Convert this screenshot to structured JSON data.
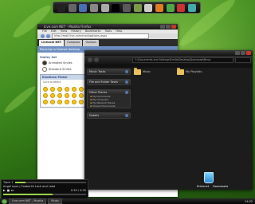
{
  "dock": {
    "icons": [
      {
        "name": "terminal-icon",
        "color": "#222"
      },
      {
        "name": "hard-drive-icon",
        "color": "#666"
      },
      {
        "name": "network-icon",
        "color": "#4a6fb0"
      },
      {
        "name": "user-folder-icon",
        "color": "#888"
      },
      {
        "name": "documents-icon",
        "color": "#aaa"
      },
      {
        "name": "gap-icon",
        "color": "#000"
      },
      {
        "name": "display-icon",
        "color": "#5a5a5a"
      },
      {
        "name": "image-icon",
        "color": "#7a9a4a"
      },
      {
        "name": "music-icon",
        "color": "#ccc"
      },
      {
        "name": "firefox-icon",
        "color": "#e07b20"
      },
      {
        "name": "messenger-icon",
        "color": "#4aa84a"
      },
      {
        "name": "settings-icon",
        "color": "#c33"
      },
      {
        "name": "trash-icon",
        "color": "#4aa"
      }
    ]
  },
  "browser": {
    "title": "Live.com NET - Mozilla Firefox",
    "menu": [
      "File",
      "Edit",
      "View",
      "History",
      "Bookmarks",
      "Tools",
      "Help"
    ],
    "url": "http://mail.live.com/mail/options.aspx",
    "tabs": [
      "Livecom NET",
      "Compose",
      "Options"
    ],
    "header": "Replying to Hotmail Desktop",
    "section_smile": "Smiley Set",
    "options": [
      {
        "label": "Animated Smiles",
        "checked": true
      },
      {
        "label": "Standard Smiles",
        "checked": false
      }
    ],
    "box_title": "Emoticon Picker",
    "box_subtitle": "Click to select"
  },
  "explorer": {
    "address": "C:\\Documents and Settings\\Emilio\\Desktop\\Download\\Music",
    "panes": [
      {
        "title": "Music Tasks",
        "items": []
      },
      {
        "title": "File and Folder Tasks",
        "items": []
      },
      {
        "title": "Other Places",
        "items": [
          "My Documents",
          "My Computer",
          "My Network Places",
          "Shared Documents"
        ]
      },
      {
        "title": "Details",
        "items": []
      }
    ],
    "folders": [
      "Music",
      "My Playlists"
    ]
  },
  "desktop": {
    "recycle_bin_label": "Ethernet",
    "downloads_label": "Downloads"
  },
  "player": {
    "line1": "Track 1",
    "line2": "Angel eyes | Foobar2k Lock and Load",
    "time": "0:39 / 4:35",
    "progress": 0.15,
    "volume": 0.6
  },
  "taskbar": {
    "items": [
      "Live.com NET - Mozilla",
      "Music"
    ],
    "clock": "14:02"
  }
}
